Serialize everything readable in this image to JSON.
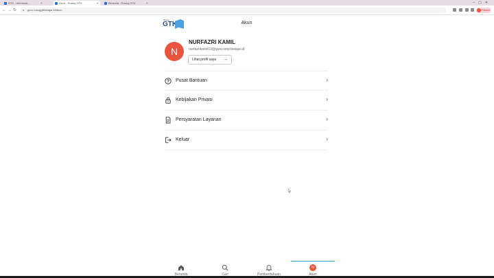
{
  "browser": {
    "tabs": [
      {
        "label": "GTK - Informasi..."
      },
      {
        "label": "Akun - Ruang GTK"
      },
      {
        "label": "Beranda - Ruang GTK"
      }
    ],
    "url": "guru.ruanggtkbelajar.id/akun",
    "profile_label": "Pribadi"
  },
  "logo": {
    "small": "Ruang",
    "big": "GTK"
  },
  "header": {
    "title": "Akun"
  },
  "user": {
    "initial": "N",
    "name": "NURFAZRI KAMIL",
    "email": "nurfazrikamil19@guru.smp.belajar.id",
    "profile_button": "Lihat profil saya"
  },
  "menu": {
    "items": [
      {
        "label": "Pusat Bantuan",
        "icon": "help-circle-icon"
      },
      {
        "label": "Kebijakan Privasi",
        "icon": "lock-icon"
      },
      {
        "label": "Persyaratan Layanan",
        "icon": "document-icon"
      },
      {
        "label": "Keluar",
        "icon": "logout-icon"
      }
    ]
  },
  "bottom_nav": {
    "items": [
      {
        "label": "Beranda",
        "icon": "home-icon"
      },
      {
        "label": "Cari",
        "icon": "search-icon"
      },
      {
        "label": "Pemberitahuan",
        "icon": "bell-icon"
      },
      {
        "label": "Akun",
        "icon": "avatar-icon"
      }
    ],
    "active": "Akun",
    "accent": "#29a7b8"
  },
  "colors": {
    "avatar": "#e8553f",
    "brand": "#2b4a87"
  }
}
